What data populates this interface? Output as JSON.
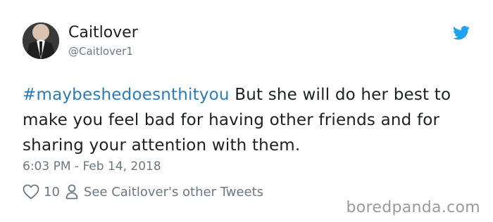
{
  "user": {
    "display_name": "Caitlover",
    "handle": "@Caitlover1",
    "avatar_icon": "profile-photo"
  },
  "tweet": {
    "hashtag": "#maybeshedoesnthityou",
    "text": " But she will do her best to make you feel bad for having other friends and for sharing your attention with them.",
    "timestamp": "6:03 PM - Feb 14, 2018"
  },
  "actions": {
    "like_count": "10",
    "see_more_label": "See Caitlover's other Tweets"
  },
  "brand": {
    "logo_icon": "twitter-bird-icon",
    "accent": "#1da1f2",
    "hashtag_color": "#2b7bb9"
  },
  "watermark": "boredpanda.com"
}
